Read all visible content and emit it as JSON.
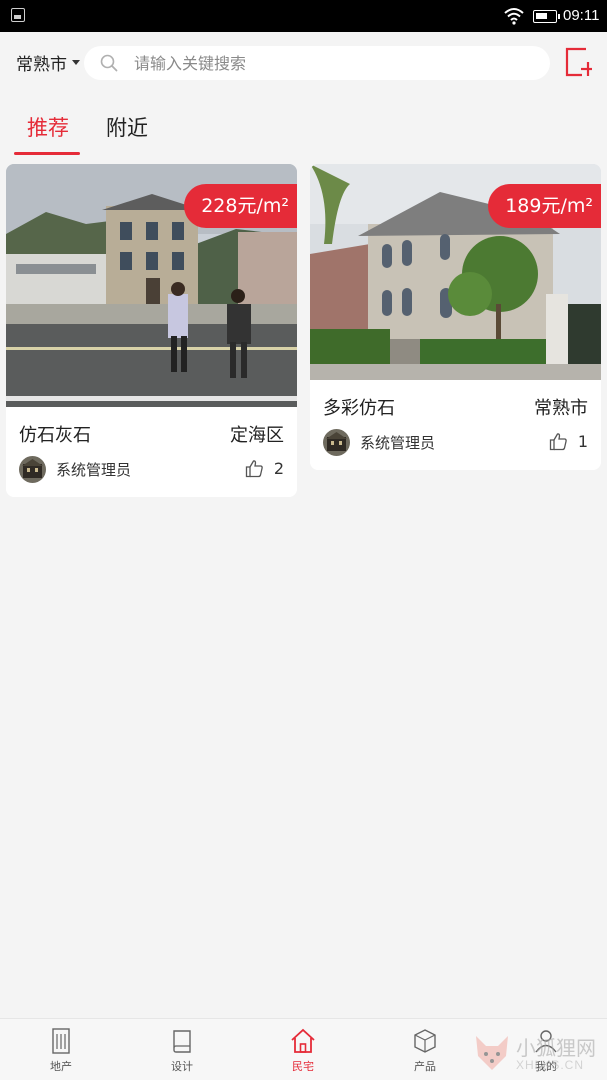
{
  "status_bar": {
    "time": "09:11"
  },
  "header": {
    "city": "常熟市",
    "search_placeholder": "请输入关键搜索",
    "icons": {
      "search": "search-icon",
      "add": "add-post-icon",
      "city_caret": "caret-down-icon"
    }
  },
  "tabs": [
    {
      "label": "推荐",
      "active": true
    },
    {
      "label": "附近",
      "active": false
    }
  ],
  "listings": [
    {
      "price": "228元/m²",
      "name": "仿石灰石",
      "district": "定海区",
      "author": "系统管理员",
      "likes": "2"
    },
    {
      "price": "189元/m²",
      "name": "多彩仿石",
      "district": "常熟市",
      "author": "系统管理员",
      "likes": "1"
    }
  ],
  "bottom_nav": [
    {
      "label": "地产",
      "icon": "building-icon",
      "active": false
    },
    {
      "label": "设计",
      "icon": "book-icon",
      "active": false
    },
    {
      "label": "民宅",
      "icon": "house-icon",
      "active": true
    },
    {
      "label": "产品",
      "icon": "box-icon",
      "active": false
    },
    {
      "label": "我的",
      "icon": "user-icon",
      "active": false
    }
  ],
  "watermark": {
    "text": "小狐狸网",
    "sub": "XHLKS.CN"
  },
  "colors": {
    "accent": "#e52b38",
    "background": "#f4f4f4",
    "card": "#ffffff"
  }
}
